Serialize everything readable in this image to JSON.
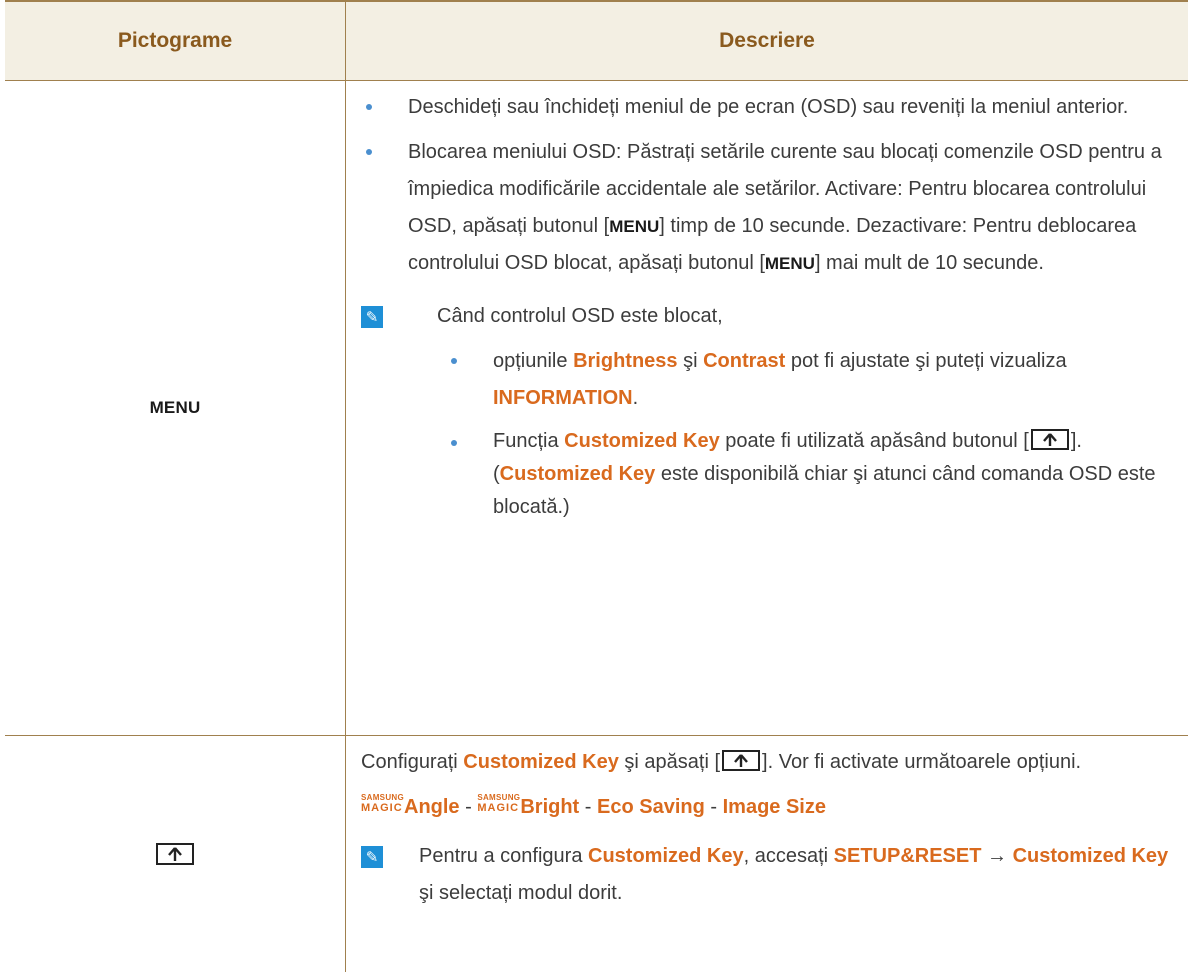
{
  "table": {
    "header": {
      "col1": "Pictograme",
      "col2": "Descriere"
    },
    "row1": {
      "icon_label": "MENU",
      "bullet1": "Deschideți sau închideți meniul de pe ecran (OSD) sau reveniți la meniul anterior.",
      "bullet2_p1": "Blocarea meniului OSD: Păstrați setările curente sau blocați comenzile OSD pentru a împiedica modificările accidentale ale setărilor. Activare: Pentru blocarea controlului OSD, apăsați butonul [",
      "bullet2_key1": "MENU",
      "bullet2_p2": "] timp de 10 secunde. Dezactivare: Pentru deblocarea controlului OSD blocat, apăsați butonul [",
      "bullet2_key2": "MENU",
      "bullet2_p3": "] mai mult de 10 secunde.",
      "note_intro": "Când controlul OSD este blocat,",
      "sub1_p1": "opțiunile ",
      "sub1_brightness": "Brightness",
      "sub1_and": " şi ",
      "sub1_contrast": "Contrast",
      "sub1_p2": " pot fi ajustate şi puteți vizualiza ",
      "sub1_information": "INFORMATION",
      "sub1_p3": ".",
      "sub2_p1": "Funcția ",
      "sub2_ck1": "Customized Key",
      "sub2_p2": " poate fi utilizată apăsând butonul [",
      "sub2_p3": "]. (",
      "sub2_ck2": "Customized Key",
      "sub2_p4": " este disponibilă chiar şi atunci când comanda OSD este blocată.)"
    },
    "row2": {
      "line1_p1": "Configurați ",
      "line1_ck": "Customized Key",
      "line1_p2": " şi apăsați [",
      "line1_p3": "]. Vor fi activate următoarele opțiuni.",
      "magic_samsung": "SAMSUNG",
      "magic_magic": "MAGIC",
      "opt_angle": "Angle",
      "sep": " - ",
      "opt_bright": "Bright",
      "opt_eco": "Eco Saving",
      "opt_image": "Image Size",
      "note_p1": "Pentru a configura ",
      "note_ck1": "Customized Key",
      "note_p2": ", accesați ",
      "note_setup": "SETUP&RESET",
      "note_arrow": " → ",
      "note_ck2": "Customized Key",
      "note_p3": " şi selectați modul dorit."
    }
  },
  "icons": {
    "note": "note-pencil-icon",
    "key": "customized-key-icon"
  },
  "colors": {
    "accent": "#d96a1e",
    "header_text": "#8a5a1e",
    "header_bg": "#f3efe3",
    "border": "#a0804e",
    "bullet": "#4a8fcf",
    "note_icon": "#1e8fd6"
  }
}
